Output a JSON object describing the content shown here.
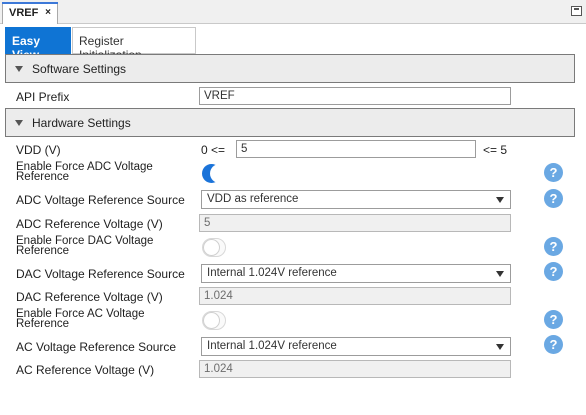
{
  "editor_tab": {
    "title": "VREF",
    "close": "×"
  },
  "view_tabs": {
    "easy_view": "Easy View",
    "register_init": "Register Initialization"
  },
  "software": {
    "header": "Software Settings",
    "api_prefix_label": "API Prefix",
    "api_prefix_value": "VREF"
  },
  "hardware": {
    "header": "Hardware Settings",
    "vdd_label": "VDD (V)",
    "vdd_min": "0 <=",
    "vdd_value": "5",
    "vdd_max": "<= 5",
    "force_adc_label": "Enable Force ADC Voltage Reference",
    "force_adc_on": true,
    "adc_source_label": "ADC Voltage Reference Source",
    "adc_source_value": "VDD as reference",
    "adc_ref_label": "ADC Reference Voltage (V)",
    "adc_ref_value": "5",
    "force_dac_label": "Enable Force DAC Voltage Reference",
    "force_dac_on": false,
    "dac_source_label": "DAC Voltage Reference Source",
    "dac_source_value": "Internal 1.024V reference",
    "dac_ref_label": "DAC Reference Voltage (V)",
    "dac_ref_value": "1.024",
    "force_ac_label": "Enable Force AC Voltage Reference",
    "force_ac_on": false,
    "ac_source_label": "AC Voltage Reference Source",
    "ac_source_value": "Internal 1.024V reference",
    "ac_ref_label": "AC Reference Voltage (V)",
    "ac_ref_value": "1.024"
  },
  "help_glyph": "?",
  "colors": {
    "accent": "#0f74d4",
    "toggle_on": "#1a73d9",
    "help": "#6aa8e3"
  }
}
